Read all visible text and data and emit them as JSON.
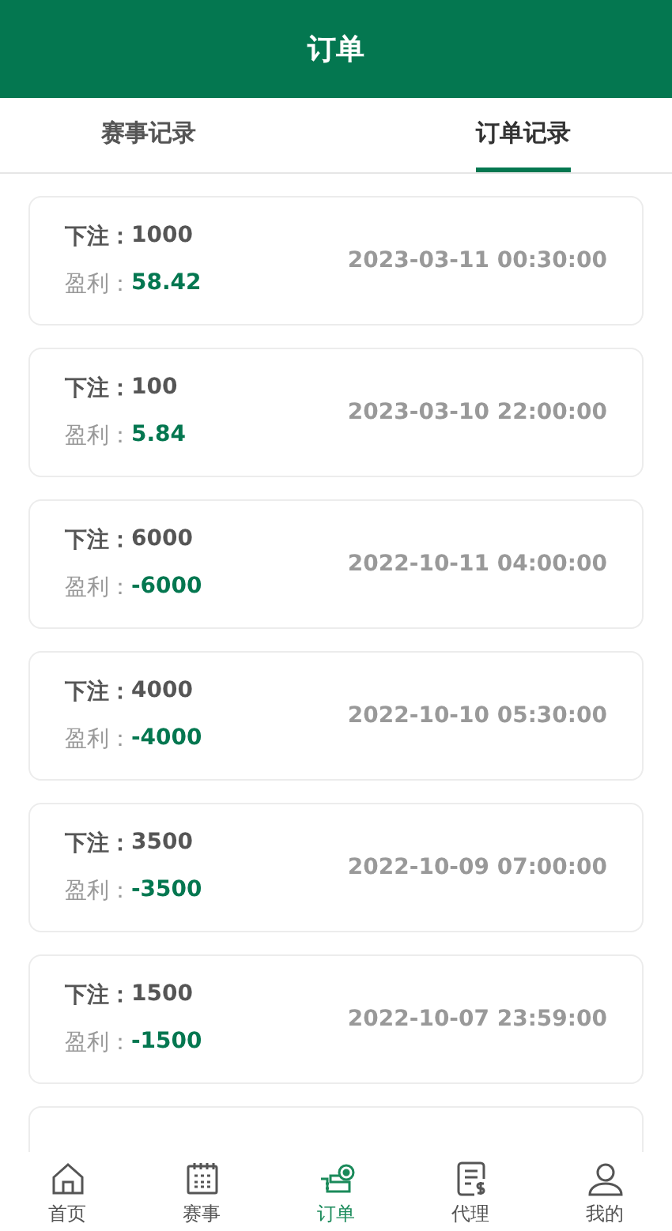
{
  "header": {
    "title": "订单"
  },
  "tabs": [
    {
      "label": "赛事记录",
      "selected": false
    },
    {
      "label": "订单记录",
      "selected": true
    }
  ],
  "orders": [
    {
      "bet_label": "下注：",
      "bet": "1000",
      "profit_label": "盈利：",
      "profit": "58.42",
      "time": "2023-03-11 00:30:00"
    },
    {
      "bet_label": "下注：",
      "bet": "100",
      "profit_label": "盈利：",
      "profit": "5.84",
      "time": "2023-03-10 22:00:00"
    },
    {
      "bet_label": "下注：",
      "bet": "6000",
      "profit_label": "盈利：",
      "profit": "-6000",
      "time": "2022-10-11 04:00:00"
    },
    {
      "bet_label": "下注：",
      "bet": "4000",
      "profit_label": "盈利：",
      "profit": "-4000",
      "time": "2022-10-10 05:30:00"
    },
    {
      "bet_label": "下注：",
      "bet": "3500",
      "profit_label": "盈利：",
      "profit": "-3500",
      "time": "2022-10-09 07:00:00"
    },
    {
      "bet_label": "下注：",
      "bet": "1500",
      "profit_label": "盈利：",
      "profit": "-1500",
      "time": "2022-10-07 23:59:00"
    }
  ],
  "nav": [
    {
      "kind": "home",
      "label": "首页",
      "selected": false
    },
    {
      "kind": "calendar",
      "label": "赛事",
      "selected": false
    },
    {
      "kind": "ticket",
      "label": "订单",
      "selected": true
    },
    {
      "kind": "bill",
      "label": "代理",
      "selected": false
    },
    {
      "kind": "user",
      "label": "我的",
      "selected": false
    }
  ]
}
